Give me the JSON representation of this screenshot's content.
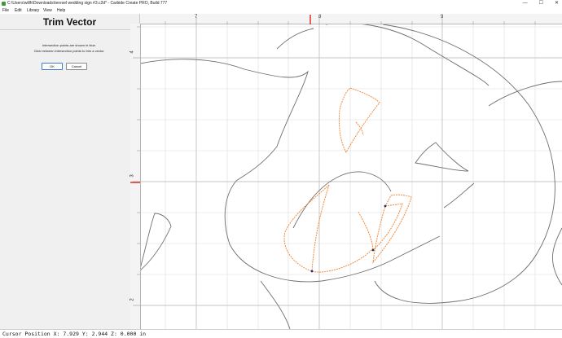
{
  "window": {
    "title": "C:\\Users\\willh\\Downloads\\teresel wedding sign #3.c2d* - Carbide Create PRO, Build 777",
    "controls": [
      "—",
      "☐",
      "✕"
    ]
  },
  "menu": [
    "File",
    "Edit",
    "Library",
    "View",
    "Help"
  ],
  "panel": {
    "title": "Trim Vector",
    "message_1": "Intersection points are shown in blue.",
    "message_2": "Click between intersection points to trim a vector.",
    "ok_label": "OK",
    "cancel_label": "Cancel"
  },
  "rulers": {
    "top_labels": [
      "7",
      "8",
      "9"
    ],
    "left_labels": [
      "4",
      "3",
      "2"
    ]
  },
  "status": {
    "cursor_text": "Cursor Position X: 7.929 Y: 2.944 Z: 0.000 in"
  },
  "colors": {
    "selected_vector": "#f08a3c",
    "vector": "#6e6e6e",
    "grid": "#dcdcdc",
    "intersection": "#1a2a6a",
    "ruler_marker": "#e02020"
  }
}
